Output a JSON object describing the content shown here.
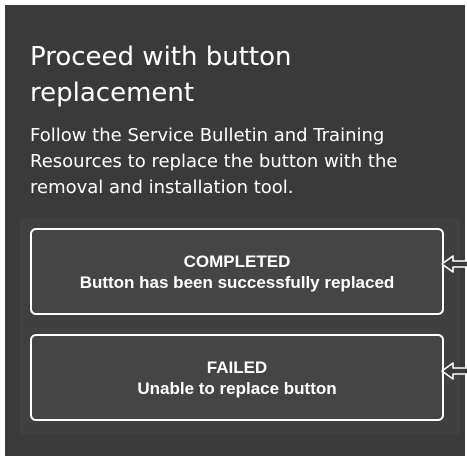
{
  "dialog": {
    "title": "Proceed with button replacement",
    "instructions": "Follow the Service Bulletin and Training Resources to replace the button with the removal and installation tool."
  },
  "options": [
    {
      "heading": "COMPLETED",
      "description": "Button has been successfully replaced"
    },
    {
      "heading": "FAILED",
      "description": "Unable to replace button"
    }
  ],
  "icons": {
    "pointer": "pointer-arrow-icon"
  },
  "colors": {
    "panel_background": "#3a3a3a",
    "options_background": "#404040",
    "text": "#ffffff",
    "button_border": "#ffffff"
  }
}
